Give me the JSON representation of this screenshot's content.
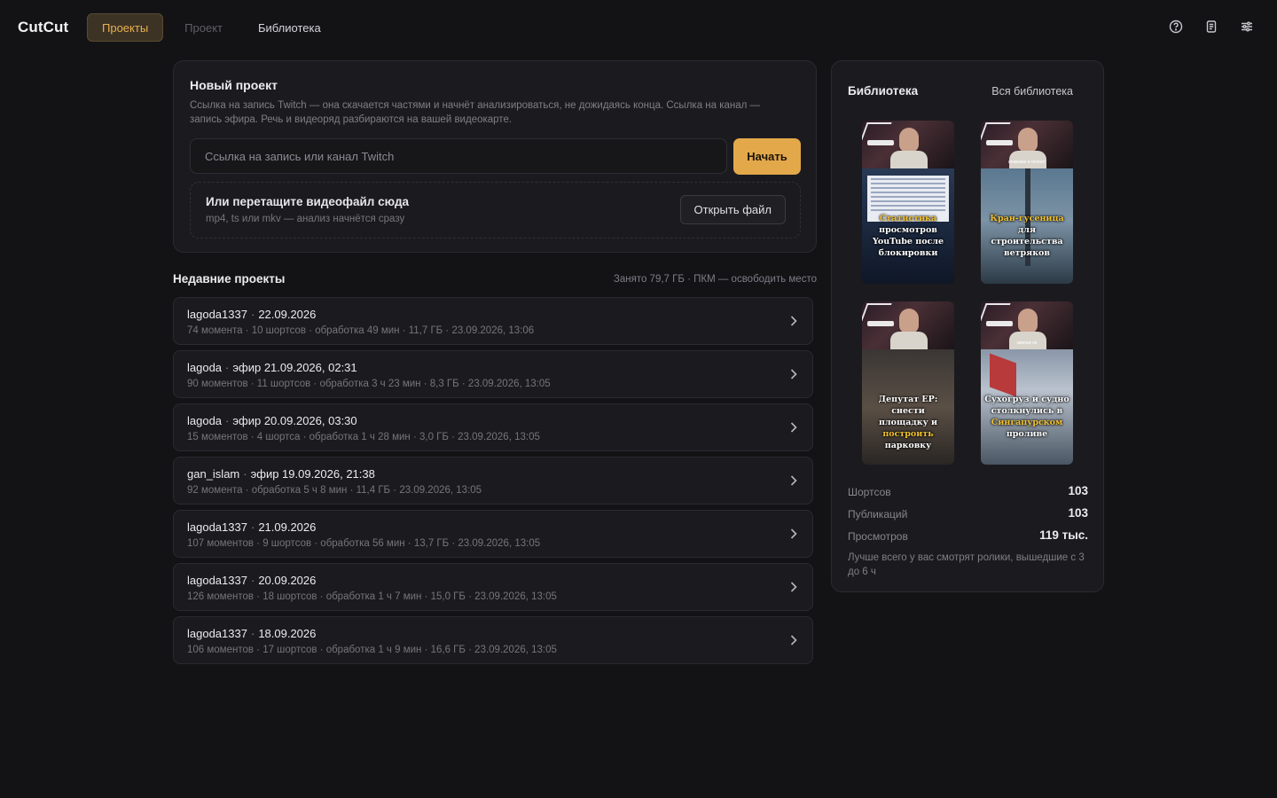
{
  "app": {
    "name": "CutCut"
  },
  "nav": {
    "tabs": [
      {
        "label": "Проекты"
      },
      {
        "label": "Проект"
      },
      {
        "label": "Библиотека"
      }
    ]
  },
  "icons": {
    "help": "help-circle-icon",
    "notes": "document-icon",
    "settings": "sliders-icon"
  },
  "accent_color": "#e3a84a",
  "new_project": {
    "title": "Новый проект",
    "description": "Ссылка на запись Twitch — она скачается частями и начнёт анализироваться, не дожидаясь конца. Ссылка на канал — запись эфира. Речь и видеоряд разбираются на вашей видеокарте.",
    "input_placeholder": "Ссылка на запись или канал Twitch",
    "input_value": "",
    "start_label": "Начать",
    "drop_title": "Или перетащите видеофайл сюда",
    "drop_subtitle": "mp4, ts или mkv — анализ начнётся сразу",
    "open_file_label": "Открыть файл"
  },
  "recent": {
    "title": "Недавние проекты",
    "meta": "Занято 79,7 ГБ · ПКМ — освободить место",
    "projects": [
      {
        "title": "lagoda1337",
        "date": "22.09.2026",
        "details": "74 момента · 10 шортсов · обработка 49 мин · 11,7 ГБ · 23.09.2026, 13:06"
      },
      {
        "title": "lagoda",
        "date": "эфир 21.09.2026, 02:31",
        "details": "90 моментов · 11 шортсов · обработка 3 ч 23 мин · 8,3 ГБ · 23.09.2026, 13:05"
      },
      {
        "title": "lagoda",
        "date": "эфир 20.09.2026, 03:30",
        "details": "15 моментов · 4 шортса · обработка 1 ч 28 мин · 3,0 ГБ · 23.09.2026, 13:05"
      },
      {
        "title": "gan_islam",
        "date": "эфир 19.09.2026, 21:38",
        "details": "92 момента · обработка 5 ч 8 мин · 11,4 ГБ · 23.09.2026, 13:05"
      },
      {
        "title": "lagoda1337",
        "date": "21.09.2026",
        "details": "107 моментов · 9 шортсов · обработка 56 мин · 13,7 ГБ · 23.09.2026, 13:05"
      },
      {
        "title": "lagoda1337",
        "date": "20.09.2026",
        "details": "126 моментов · 18 шортсов · обработка 1 ч 7 мин · 15,0 ГБ · 23.09.2026, 13:05"
      },
      {
        "title": "lagoda1337",
        "date": "18.09.2026",
        "details": "106 моментов · 17 шортсов · обработка 1 ч 9 мин · 16,6 ГБ · 23.09.2026, 13:05"
      }
    ]
  },
  "library": {
    "title": "Библиотека",
    "all_label": "Вся библиотека",
    "thumbnails": [
      {
        "caption_hl": "Статистика",
        "caption": "просмотров YouTube после блокировки",
        "cam_caption": ""
      },
      {
        "caption_hl": "Кран-гусеница",
        "caption": "для строительства ветряков",
        "cam_caption": "ножками и полает"
      },
      {
        "caption": "Депутат ЕР: снести площадку и",
        "caption_hl": "построить",
        "caption_tail": "парковку",
        "cam_caption": ""
      },
      {
        "caption": "Сухогруз и судно столкнулись в",
        "caption_hl": "Сингапурском",
        "caption_tail": "проливе",
        "cam_caption": "экипаж не"
      }
    ],
    "stats": [
      {
        "label": "Шортсов",
        "value": "103"
      },
      {
        "label": "Публикаций",
        "value": "103"
      },
      {
        "label": "Просмотров",
        "value": "119 тыс."
      }
    ],
    "note": "Лучше всего у вас смотрят ролики, вышедшие с 3 до 6 ч"
  }
}
